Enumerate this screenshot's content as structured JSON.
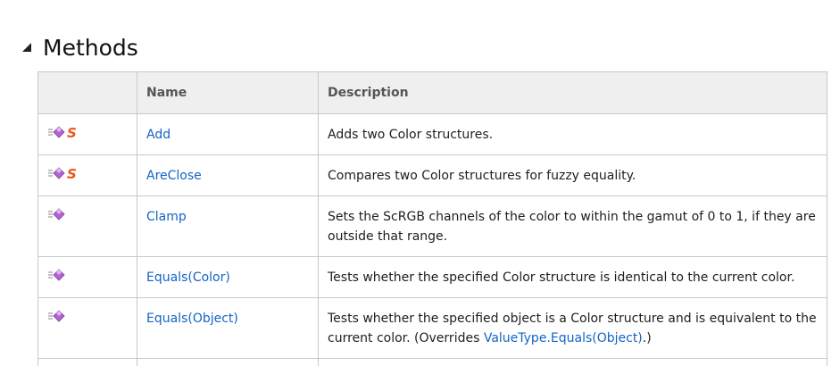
{
  "section": {
    "title": "Methods"
  },
  "table": {
    "headers": {
      "icon": "",
      "name": "Name",
      "description": "Description"
    },
    "rows": [
      {
        "name": "Add",
        "description": "Adds two Color structures.",
        "static": true
      },
      {
        "name": "AreClose",
        "description": "Compares two Color structures for fuzzy equality.",
        "static": true
      },
      {
        "name": "Clamp",
        "description": "Sets the ScRGB channels of the color to within the gamut of 0 to 1, if they are outside that range.",
        "static": false
      },
      {
        "name": "Equals(Color)",
        "description": "Tests whether the specified Color structure is identical to the current color.",
        "static": false
      },
      {
        "name": "Equals(Object)",
        "description_before": "Tests whether the specified object is a Color structure and is equivalent to the current color. (Overrides ",
        "description_link": "ValueType.Equals(Object)",
        "description_after": ".)",
        "static": false
      }
    ]
  },
  "icons": {
    "collapse": "collapse-triangle-icon",
    "method": "public-method-icon",
    "static": "static-member-icon"
  },
  "colors": {
    "link": "#1364c4",
    "header_bg": "#efefef",
    "border": "#c8c8c8",
    "method_icon": "#b562d6",
    "static_icon": "#e8581c"
  }
}
